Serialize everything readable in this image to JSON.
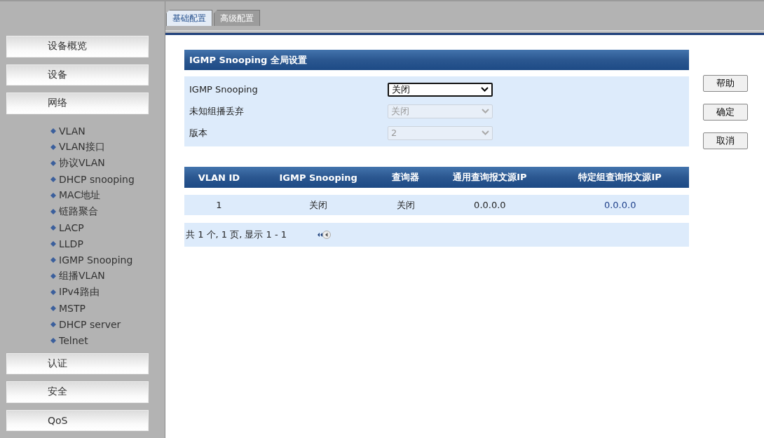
{
  "tabs": [
    {
      "label": "基础配置",
      "selected": true
    },
    {
      "label": "高级配置",
      "selected": false
    }
  ],
  "sidebar": {
    "sections": [
      {
        "label": "设备概览"
      },
      {
        "label": "设备"
      },
      {
        "label": "网络",
        "children": [
          "VLAN",
          "VLAN接口",
          "协议VLAN",
          "DHCP snooping",
          "MAC地址",
          "链路聚合",
          "LACP",
          "LLDP",
          "IGMP Snooping",
          "组播VLAN",
          "IPv4路由",
          "MSTP",
          "DHCP server",
          "Telnet"
        ]
      },
      {
        "label": "认证"
      },
      {
        "label": "安全"
      },
      {
        "label": "QoS"
      }
    ]
  },
  "global_settings": {
    "title": "IGMP Snooping 全局设置",
    "fields": [
      {
        "label": "IGMP Snooping",
        "value": "关闭",
        "disabled": false
      },
      {
        "label": "未知组播丢弃",
        "value": "关闭",
        "disabled": true
      },
      {
        "label": "版本",
        "value": "2",
        "disabled": true
      }
    ]
  },
  "table": {
    "columns": [
      "VLAN ID",
      "IGMP Snooping",
      "查询器",
      "通用查询报文源IP",
      "特定组查询报文源IP"
    ],
    "rows": [
      [
        "1",
        "关闭",
        "关闭",
        "0.0.0.0",
        "0.0.0.0"
      ]
    ],
    "pager": "共 1 个, 1 页, 显示 1 - 1"
  },
  "buttons": [
    "帮助",
    "确定",
    "取消"
  ]
}
